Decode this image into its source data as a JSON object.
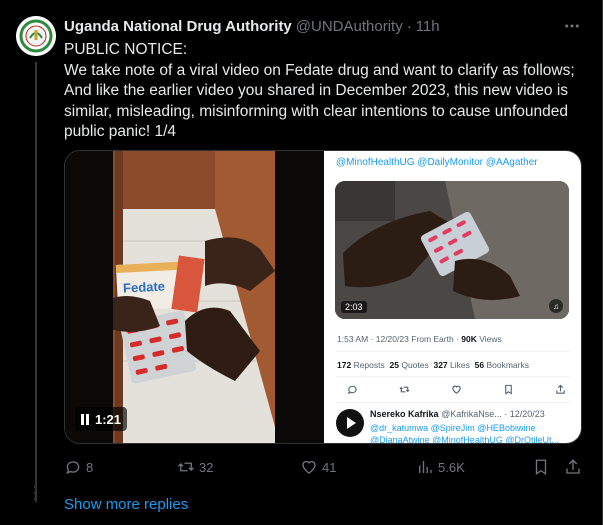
{
  "tweet": {
    "author_name": "Uganda National Drug Authority",
    "handle": "@UNDAuthority",
    "separator": "·",
    "time": "11h",
    "text_lines": [
      "PUBLIC NOTICE:",
      "We take note of a viral video on Fedate drug and want to clarify as follows;",
      "And like the earlier video you shared in December 2023, this new video is",
      "similar, misleading, misinforming with clear intentions to cause unfounded",
      "public panic! 1/4"
    ],
    "more_icon": "more-horizontal-icon"
  },
  "video": {
    "duration": "1:21",
    "package_label": "Fedate"
  },
  "embedded_screenshot": {
    "mentions": "@MinofHealthUG @DailyMonitor @AAgather",
    "video_duration": "2:03",
    "timestamp": "1:53 AM · 12/20/23 From Earth ·",
    "views_count": "90K",
    "views_label": "Views",
    "reposts_count": "172",
    "reposts_label": "Reposts",
    "quotes_count": "25",
    "quotes_label": "Quotes",
    "likes_count": "327",
    "likes_label": "Likes",
    "bookmarks_count": "56",
    "bookmarks_label": "Bookmarks",
    "reply_name": "Nsereko Kafrika",
    "reply_handle": "@KafrikaNse...",
    "reply_date": "· 12/20/23",
    "reply_text": "@dr_katumwa @SpireJim @HEBobiwine @DianaAtwine @MinofHealthUG @DrOtileUt..."
  },
  "actions": {
    "replies": "8",
    "reposts": "32",
    "likes": "41",
    "views": "5.6K"
  },
  "show_more_replies": "Show more replies",
  "colors": {
    "background": "#000000",
    "text": "#e7e9ea",
    "muted": "#71767b",
    "link": "#1d9bf0",
    "border": "#2f3336"
  }
}
